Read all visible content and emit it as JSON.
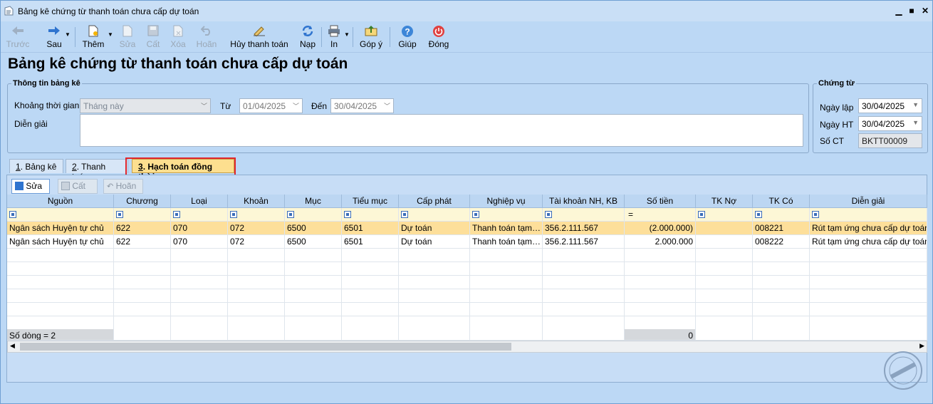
{
  "window": {
    "title": "Bảng kê chứng từ thanh toán chưa cấp dự toán"
  },
  "toolbar": {
    "back": "Trước",
    "forward": "Sau",
    "add": "Thêm",
    "edit": "Sửa",
    "cut": "Cất",
    "delete": "Xóa",
    "undo": "Hoãn",
    "cancel_payment": "Hủy thanh toán",
    "reload": "Nạp",
    "print": "In",
    "feedback": "Góp ý",
    "help": "Giúp",
    "close": "Đóng"
  },
  "heading": "Bảng kê chứng từ thanh toán chưa cấp dự toán",
  "info": {
    "legend": "Thông tin bảng kê",
    "period_label": "Khoảng thời gian",
    "period_value": "Tháng này",
    "from_label": "Từ",
    "from_value": "01/04/2025",
    "to_label": "Đến",
    "to_value": "30/04/2025",
    "desc_label": "Diễn giải",
    "desc_value": ""
  },
  "doc": {
    "legend": "Chứng từ",
    "date_created_label": "Ngày lập",
    "date_created": "30/04/2025",
    "date_posted_label": "Ngày HT",
    "date_posted": "30/04/2025",
    "number_label": "Số CT",
    "number": "BKTT00009"
  },
  "tabs": [
    {
      "key": "1",
      "label": ". Bảng kê"
    },
    {
      "key": "2",
      "label": ". Thanh toán"
    },
    {
      "key": "3",
      "label": ". Hạch toán đồng thời"
    }
  ],
  "grid_toolbar": {
    "edit": "Sửa",
    "save": "Cất",
    "undo": "Hoãn"
  },
  "columns": [
    "Nguồn",
    "Chương",
    "Loại",
    "Khoản",
    "Mục",
    "Tiểu mục",
    "Cấp phát",
    "Nghiệp vụ",
    "Tài khoản NH, KB",
    "Số tiền",
    "TK Nợ",
    "TK Có",
    "Diễn giải"
  ],
  "filter_amount_op": "=",
  "rows": [
    [
      "Ngân sách Huyện tự chủ",
      "622",
      "070",
      "072",
      "6500",
      "6501",
      "Dự toán",
      "Thanh toán tạm…",
      "356.2.111.567",
      "(2.000.000)",
      "",
      "008221",
      "Rút tạm ứng chưa cấp dự toán"
    ],
    [
      "Ngân sách Huyện tự chủ",
      "622",
      "070",
      "072",
      "6500",
      "6501",
      "Dự toán",
      "Thanh toán tạm…",
      "356.2.111.567",
      "2.000.000",
      "",
      "008222",
      "Rút tạm ứng chưa cấp dự toán"
    ]
  ],
  "footer": {
    "count": "Số dòng = 2",
    "total": "0"
  },
  "colors": {
    "window_bg": "#bcd8f5",
    "selected_row": "#fddf9a",
    "active_tab": "#fddf8f",
    "highlight_border": "#e0262c"
  }
}
